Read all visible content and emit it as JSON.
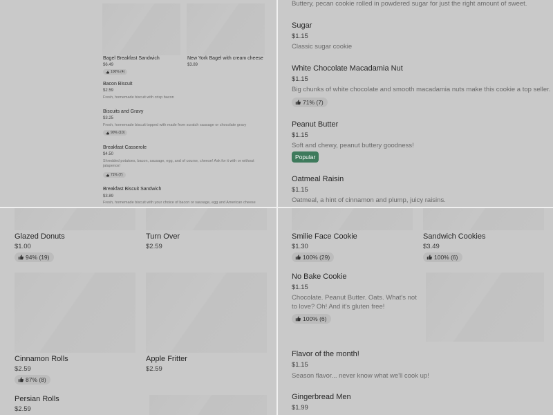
{
  "top_left": {
    "items": [
      {
        "name": "Bagel Breakfast Sandwich",
        "price": "$6.49",
        "rating": "100% (4)"
      },
      {
        "name": "New York Bagel with cream cheese",
        "price": "$3.89"
      },
      {
        "name": "Bacon Biscuit",
        "price": "$2.59",
        "description": "Fresh, homemade biscuit with crisp bacon"
      },
      {
        "name": "Biscuits and Gravy",
        "price": "$3.25",
        "description": "Fresh, homemade biscuit topped with made from scratch sausage or chocolate gravy",
        "rating": "90% (10)"
      },
      {
        "name": "Breakfast Casserole",
        "price": "$4.50",
        "description": "Shredded potatoes, bacon, sausage, egg, and of course, cheese! Ask for it with or without jalapenos!",
        "rating": "71% (7)"
      },
      {
        "name": "Breakfast Biscuit Sandwich",
        "price": "$3.89",
        "description": "Fresh, homemade biscuit with your choice of bacon or sausage, egg and American cheese"
      }
    ]
  },
  "top_right": {
    "intro_desc": "Buttery, pecan cookie rolled in powdered sugar for just the right amount of sweet.",
    "items": [
      {
        "name": "Sugar",
        "price": "$1.15",
        "description": "Classic sugar cookie"
      },
      {
        "name": "White Chocolate Macadamia Nut",
        "price": "$1.15",
        "description": "Big chunks of white chocolate and smooth macadamia nuts make this cookie a top seller.",
        "rating": "71% (7)"
      },
      {
        "name": "Peanut Butter",
        "price": "$1.15",
        "description": "Soft and chewy, peanut buttery goodness!",
        "tag": "Popular"
      },
      {
        "name": "Oatmeal Raisin",
        "price": "$1.15",
        "description": "Oatmeal, a hint of cinnamon and plump, juicy raisins."
      }
    ]
  },
  "bottom_left": {
    "items": [
      {
        "name": "Glazed Donuts",
        "price": "$1.00",
        "rating": "94% (19)"
      },
      {
        "name": "Turn Over",
        "price": "$2.59"
      },
      {
        "name": "Cinnamon Rolls",
        "price": "$2.59",
        "rating": "87% (8)"
      },
      {
        "name": "Apple Fritter",
        "price": "$2.59"
      },
      {
        "name": "Persian Rolls",
        "price": "$2.59"
      }
    ]
  },
  "bottom_right": {
    "items": [
      {
        "name": "Smilie Face Cookie",
        "price": "$1.30",
        "rating": "100% (29)"
      },
      {
        "name": "Sandwich Cookies",
        "price": "$3.49",
        "rating": "100% (6)"
      },
      {
        "name": "No Bake Cookie",
        "price": "$1.15",
        "description": "Chocolate. Peanut Butter. Oats. What's not to love? Oh! And it's gluten free!",
        "rating": "100% (6)"
      },
      {
        "name": "Flavor of the month!",
        "price": "$1.15",
        "description": "Season flavor... never know what we'll cook up!"
      },
      {
        "name": "Gingerbread Men",
        "price": "$1.99"
      }
    ]
  },
  "colors": {
    "popular_tag": "#3e7a5c",
    "overlay": "#c9c9c9",
    "divider": "#f0f0f0"
  },
  "icons": {
    "rating": "thumbs-up-icon"
  }
}
